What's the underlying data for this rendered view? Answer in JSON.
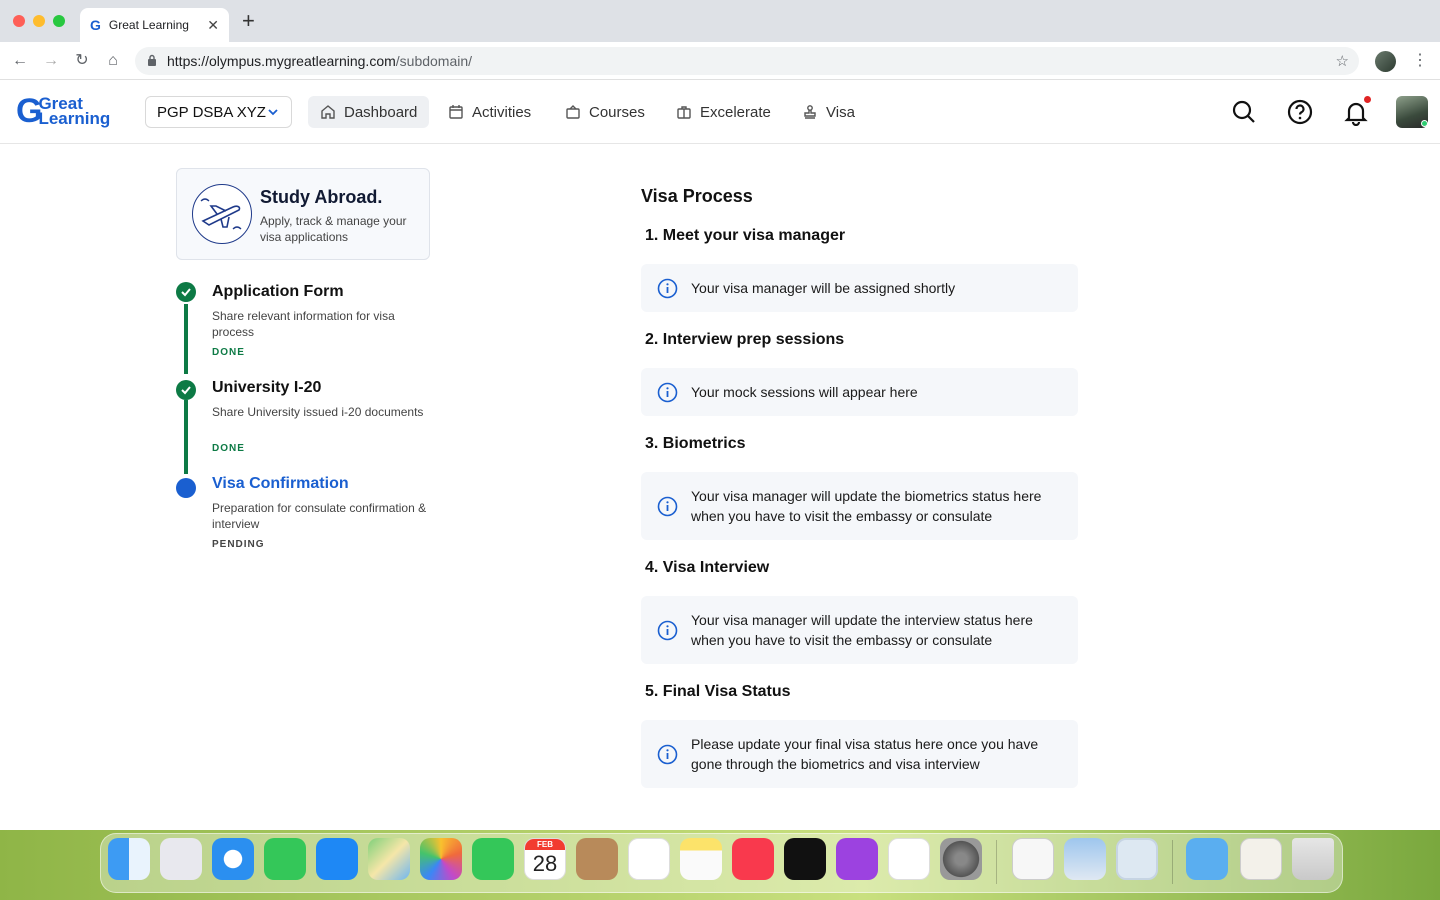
{
  "browser": {
    "tab_title": "Great Learning",
    "url_host": "https://olympus.mygreatlearning.com",
    "url_path": "/subdomain/"
  },
  "header": {
    "logo_line1": "Great",
    "logo_line2": "Learning",
    "program": "PGP DSBA XYZ",
    "nav": [
      "Dashboard",
      "Activities",
      "Courses",
      "Excelerate",
      "Visa"
    ],
    "active_nav": "Dashboard"
  },
  "promo": {
    "title": "Study Abroad.",
    "subtitle": "Apply, track & manage your visa applications"
  },
  "steps": [
    {
      "title": "Application Form",
      "desc": "Share relevant information for visa process",
      "status": "DONE"
    },
    {
      "title": "University I-20",
      "desc": "Share University issued i-20 documents",
      "status": "DONE"
    },
    {
      "title": "Visa Confirmation",
      "desc": "Preparation for consulate confirmation & interview",
      "status": "PENDING"
    }
  ],
  "visa": {
    "title": "Visa Process",
    "sections": [
      {
        "num": "1.",
        "title": "Meet your visa manager",
        "info": "Your visa manager will be assigned shortly"
      },
      {
        "num": "2.",
        "title": "Interview prep sessions",
        "info": "Your mock sessions will appear here"
      },
      {
        "num": "3.",
        "title": "Biometrics",
        "info": "Your visa manager will update the biometrics status here when you have to visit the embassy or consulate"
      },
      {
        "num": "4.",
        "title": "Visa Interview",
        "info": "Your visa manager will update the interview status here when you have to visit the embassy or consulate"
      },
      {
        "num": "5.",
        "title": "Final Visa Status",
        "info": "Please update your final visa status here once you have gone through the biometrics and visa interview"
      }
    ]
  },
  "dock": {
    "calendar_month": "FEB",
    "calendar_day": "28"
  },
  "colors": {
    "brand": "#1a5fd0",
    "done": "#0d7a45",
    "notification": "#e02424"
  }
}
